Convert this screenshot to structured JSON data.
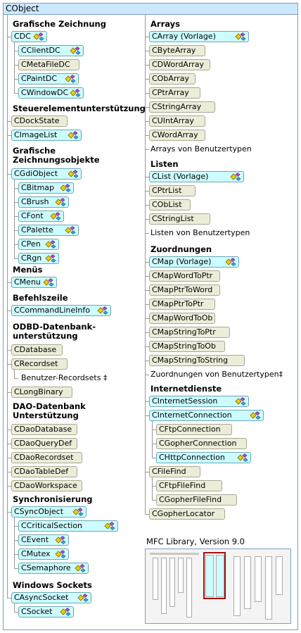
{
  "root": "CObject",
  "left_column": [
    {
      "heading": "Grafische Zeichnung",
      "classes": [
        {
          "name": "CDC",
          "serializable": true,
          "children": [
            {
              "name": "CClientDC",
              "serializable": true
            },
            {
              "name": "CMetaFileDC",
              "serializable": false
            },
            {
              "name": "CPaintDC",
              "serializable": true
            },
            {
              "name": "CWindowDC",
              "serializable": true
            }
          ]
        }
      ]
    },
    {
      "heading": "Steuerelementunterstützung",
      "classes": [
        {
          "name": "CDockState",
          "serializable": false
        },
        {
          "name": "CImageList",
          "serializable": true
        }
      ]
    },
    {
      "heading": "Grafische Zeichnungsobjekte",
      "classes": [
        {
          "name": "CGdiObject",
          "serializable": true,
          "children": [
            {
              "name": "CBitmap",
              "serializable": true
            },
            {
              "name": "CBrush",
              "serializable": true
            },
            {
              "name": "CFont",
              "serializable": true
            },
            {
              "name": "CPalette",
              "serializable": true
            },
            {
              "name": "CPen",
              "serializable": true
            },
            {
              "name": "CRgn",
              "serializable": true
            }
          ]
        }
      ]
    },
    {
      "heading": "Menüs",
      "classes": [
        {
          "name": "CMenu",
          "serializable": true
        }
      ]
    },
    {
      "heading": "Befehlszeile",
      "classes": [
        {
          "name": "CCommandLineInfo",
          "serializable": true
        }
      ]
    },
    {
      "heading": "ODBD-Datenbank-unterstützung",
      "classes": [
        {
          "name": "CDatabase",
          "serializable": false
        },
        {
          "name": "CRecordset",
          "serializable": false,
          "text_children": [
            "Benutzer-Recordsets ‡"
          ]
        },
        {
          "name": "CLongBinary",
          "serializable": false
        }
      ]
    },
    {
      "heading": "DAO-Datenbank Unterstützung",
      "classes": [
        {
          "name": "CDaoDatabase",
          "serializable": false
        },
        {
          "name": "CDaoQueryDef",
          "serializable": false
        },
        {
          "name": "CDaoRecordset",
          "serializable": false
        },
        {
          "name": "CDaoTableDef",
          "serializable": false
        },
        {
          "name": "CDaoWorkspace",
          "serializable": false
        }
      ]
    },
    {
      "heading": "Synchronisierung",
      "classes": [
        {
          "name": "CSyncObject",
          "serializable": true,
          "children": [
            {
              "name": "CCriticalSection",
              "serializable": true
            },
            {
              "name": "CEvent",
              "serializable": true
            },
            {
              "name": "CMutex",
              "serializable": true
            },
            {
              "name": "CSemaphore",
              "serializable": true
            }
          ]
        }
      ]
    },
    {
      "heading": "Windows Sockets",
      "classes": [
        {
          "name": "CAsyncSocket",
          "serializable": true,
          "children": [
            {
              "name": "CSocket",
              "serializable": true
            }
          ]
        }
      ]
    }
  ],
  "right_column": [
    {
      "heading": "Arrays",
      "classes": [
        {
          "name": "CArray (Vorlage)",
          "serializable": true
        },
        {
          "name": "CByteArray",
          "serializable": false
        },
        {
          "name": "CDWordArray",
          "serializable": false
        },
        {
          "name": "CObArray",
          "serializable": false
        },
        {
          "name": "CPtrArray",
          "serializable": false
        },
        {
          "name": "CStringArray",
          "serializable": false
        },
        {
          "name": "CUIntArray",
          "serializable": false
        },
        {
          "name": "CWordArray",
          "serializable": false
        }
      ],
      "text_items": [
        "Arrays von Benutzertypen"
      ]
    },
    {
      "heading": "Listen",
      "classes": [
        {
          "name": "CList (Vorlage)",
          "serializable": true
        },
        {
          "name": "CPtrList",
          "serializable": false
        },
        {
          "name": "CObList",
          "serializable": false
        },
        {
          "name": "CStringList",
          "serializable": false
        }
      ],
      "text_items": [
        "Listen von Benutzertypen"
      ]
    },
    {
      "heading": "Zuordnungen",
      "classes": [
        {
          "name": "CMap (Vorlage)",
          "serializable": true
        },
        {
          "name": "CMapWordToPtr",
          "serializable": false
        },
        {
          "name": "CMapPtrToWord",
          "serializable": false
        },
        {
          "name": "CMapPtrToPtr",
          "serializable": false
        },
        {
          "name": "CMapWordToOb",
          "serializable": false
        },
        {
          "name": "CMapStringToPtr",
          "serializable": false
        },
        {
          "name": "CMapStringToOb",
          "serializable": false
        },
        {
          "name": "CMapStringToString",
          "serializable": false
        }
      ],
      "text_items": [
        "Zuordnungen von Benutzertypen‡"
      ]
    },
    {
      "heading": "Internetdienste",
      "classes": [
        {
          "name": "CInternetSession",
          "serializable": true
        },
        {
          "name": "CInternetConnection",
          "serializable": true,
          "children": [
            {
              "name": "CFtpConnection",
              "serializable": false
            },
            {
              "name": "CGopherConnection",
              "serializable": false
            },
            {
              "name": "CHttpConnection",
              "serializable": true
            }
          ]
        },
        {
          "name": "CFileFind",
          "serializable": false,
          "children": [
            {
              "name": "CFtpFileFind",
              "serializable": false
            },
            {
              "name": "CGopherFileFind",
              "serializable": false
            }
          ]
        },
        {
          "name": "CGopherLocator",
          "serializable": false
        }
      ]
    }
  ],
  "caption": "MFC Library, Version 9.0",
  "colors": {
    "serializable_fill": "#ccfcff",
    "plain_fill": "#ecedd9",
    "frame": "#7f9db9",
    "highlight": "#a01010"
  }
}
